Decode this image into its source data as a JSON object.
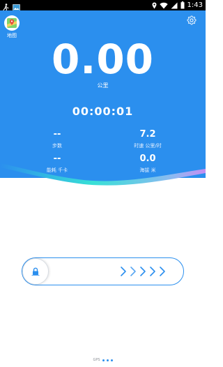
{
  "status_bar": {
    "time": "1:43",
    "icons": [
      "runner-icon",
      "image-icon",
      "location-icon",
      "wifi-icon",
      "signal-icon",
      "battery-icon"
    ]
  },
  "header": {
    "map_label": "地图",
    "settings_icon": "gear-icon"
  },
  "main": {
    "distance": "0.00",
    "distance_unit": "公里",
    "duration": "00:00:01",
    "stats": {
      "steps": {
        "value": "--",
        "label": "步数"
      },
      "speed": {
        "value": "7.2",
        "label": "时速 公里/时"
      },
      "calories": {
        "value": "--",
        "label": "能耗 千卡"
      },
      "altitude": {
        "value": "0.0",
        "label": "海拔 米"
      }
    }
  },
  "slider": {
    "knob_icon": "lock-icon",
    "arrow_icon": "chevron-right-icon"
  },
  "gps": {
    "label": "GPS",
    "signal_dots": 3
  },
  "colors": {
    "accent": "#2b8fee",
    "wave_cyan": "#38e0d6",
    "wave_purple": "#c58cf2"
  }
}
